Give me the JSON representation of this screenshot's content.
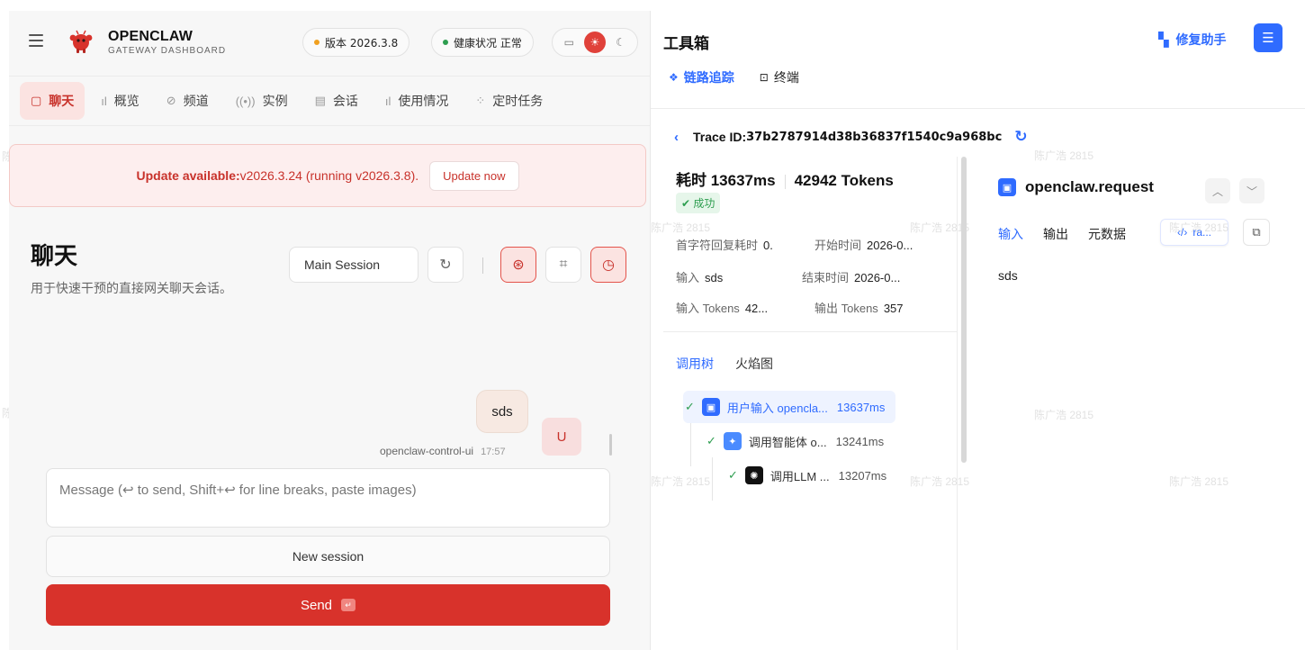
{
  "header": {
    "brand_name": "OPENCLAW",
    "brand_sub": "GATEWAY DASHBOARD",
    "version_label": "版本 2026.3.8",
    "version_dot_color": "#f0a020",
    "health_label": "健康状况 正常",
    "health_dot_color": "#2e9e50",
    "theme_options": [
      "monitor-icon",
      "sun-icon",
      "moon-icon"
    ],
    "theme_active": "sun-icon"
  },
  "nav": {
    "items": [
      {
        "label": "聊天",
        "icon": "chat-icon",
        "active": true
      },
      {
        "label": "概览",
        "icon": "bar-chart-icon"
      },
      {
        "label": "频道",
        "icon": "link-icon"
      },
      {
        "label": "实例",
        "icon": "radio-icon"
      },
      {
        "label": "会话",
        "icon": "document-icon"
      },
      {
        "label": "使用情况",
        "icon": "bar-chart-icon"
      },
      {
        "label": "定时任务",
        "icon": "spinner-icon"
      }
    ]
  },
  "banner": {
    "bold": "Update available:",
    "text": " v2026.3.24 (running v2026.3.8).",
    "button": "Update now"
  },
  "chat": {
    "title": "聊天",
    "subtitle": "用于快速干预的直接网关聊天会话。",
    "session": "Main Session",
    "message_text": "sds",
    "sender": "openclaw-control-ui",
    "time": "17:57",
    "avatar": "U",
    "input_placeholder": "Message (↩ to send, Shift+↩ for line breaks, paste images)",
    "new_session": "New session",
    "send": "Send",
    "send_kbd": "↵"
  },
  "watermark": "陈广浩 2815",
  "toolbox": {
    "title": "工具箱",
    "repair_label": "修复助手",
    "tabs": [
      {
        "label": "链路追踪",
        "icon": "trace-icon",
        "active": true
      },
      {
        "label": "终端",
        "icon": "terminal-icon"
      }
    ],
    "trace_prefix": "Trace ID: ",
    "trace_id": "37b2787914d38b36837f1540c9a968bc",
    "duration": "耗时 13637ms",
    "tokens": "42942 Tokens",
    "status": "成功",
    "kv": [
      {
        "label": "首字符回复耗时",
        "value": "0."
      },
      {
        "label": "开始时间",
        "value": "2026-0..."
      },
      {
        "label": "输入",
        "value": "sds"
      },
      {
        "label": "结束时间",
        "value": "2026-0..."
      },
      {
        "label": "输入 Tokens",
        "value": "42..."
      },
      {
        "label": "输出 Tokens",
        "value": "357"
      }
    ],
    "subtabs": [
      {
        "label": "调用树",
        "active": true
      },
      {
        "label": "火焰图"
      }
    ],
    "tree": [
      {
        "label": "用户输入 opencla...",
        "ms": "13637ms",
        "color": "#2f6bff",
        "icon": "user-input-icon"
      },
      {
        "label": "调用智能体 o...",
        "ms": "13241ms",
        "color": "#4a8bff",
        "icon": "sparkle-icon"
      },
      {
        "label": "调用LLM ...",
        "ms": "13207ms",
        "color": "#111111",
        "icon": "llm-icon"
      }
    ],
    "detail": {
      "title": "openclaw.request",
      "io_tabs": [
        {
          "label": "输入",
          "active": true
        },
        {
          "label": "输出"
        },
        {
          "label": "元数据"
        }
      ],
      "raw_label": "ra...",
      "body": "sds"
    }
  }
}
